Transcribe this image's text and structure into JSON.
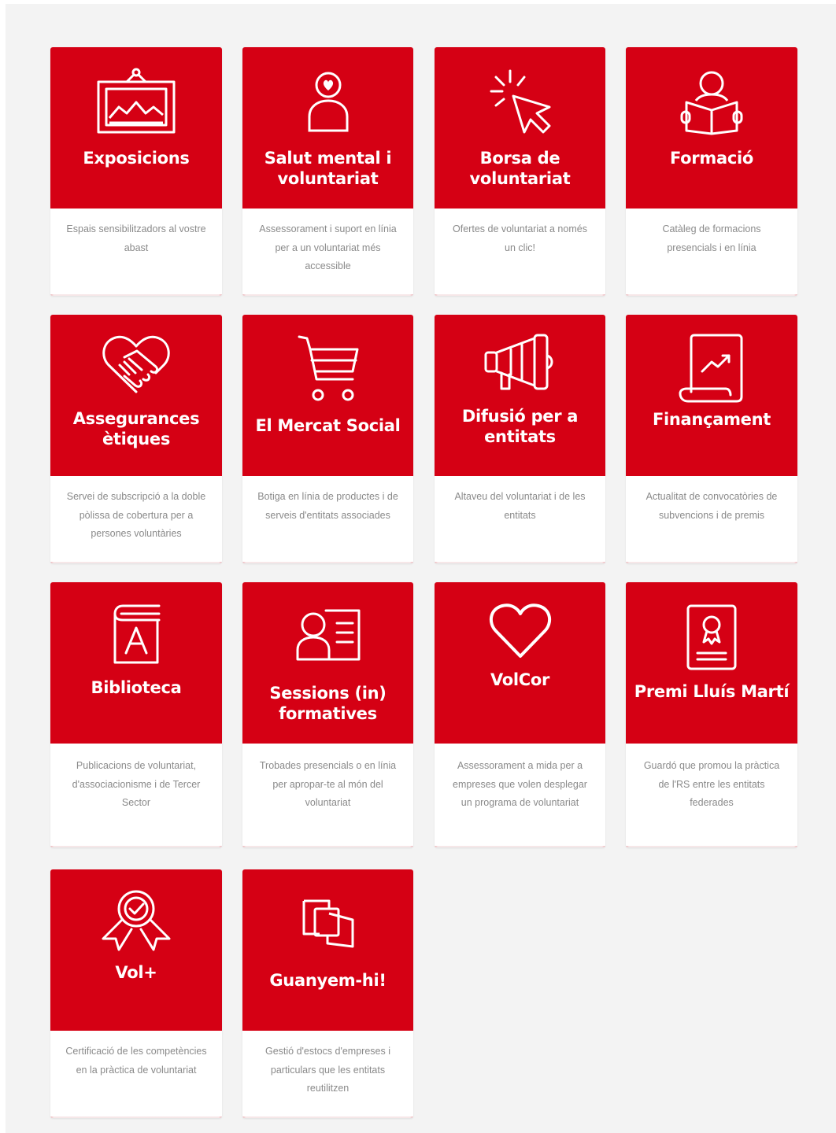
{
  "colors": {
    "accent_red": "#d50014",
    "page_bg": "#f3f3f3",
    "card_bg": "#ffffff",
    "description_text": "#8a8a8a"
  },
  "cards": [
    {
      "title": "Exposicions",
      "icon": "framed-picture-icon",
      "description": "Espais sensibilitzadors al vostre abast"
    },
    {
      "title": "Salut mental i voluntariat",
      "icon": "person-heart-icon",
      "description": "Assessorament i suport en línia per a un voluntariat més accessible"
    },
    {
      "title": "Borsa de voluntariat",
      "icon": "cursor-click-icon",
      "description": "Ofertes de voluntariat a només un clic!"
    },
    {
      "title": "Formació",
      "icon": "person-reading-icon",
      "description": "Catàleg de formacions presencials i en línia"
    },
    {
      "title": "Assegurances ètiques",
      "icon": "handshake-heart-icon",
      "description": "Servei de subscripció a la doble pòlissa de cobertura per a persones voluntàries"
    },
    {
      "title": "El Mercat Social",
      "icon": "shopping-cart-icon",
      "description": "Botiga en línia de productes i de serveis d'entitats associades"
    },
    {
      "title": "Difusió per a entitats",
      "icon": "megaphone-icon",
      "description": "Altaveu del voluntariat i de les entitats"
    },
    {
      "title": "Finançament",
      "icon": "document-chart-icon",
      "description": "Actualitat de convocatòries de subvencions i de premis"
    },
    {
      "title": "Biblioteca",
      "icon": "book-icon",
      "description": "Publicacions de voluntariat, d'associacionisme i de Tercer Sector"
    },
    {
      "title": "Sessions (in) formatives",
      "icon": "id-card-icon",
      "description": "Trobades presencials o en línia per apropar-te al món del voluntariat"
    },
    {
      "title": "VolCor",
      "icon": "heart-icon",
      "description": "Assessorament a mida per a empreses que volen desplegar un programa de voluntariat"
    },
    {
      "title": "Premi Lluís Martí",
      "icon": "award-certificate-icon",
      "description": "Guardó que promou la pràctica de l'RS entre les entitats federades"
    },
    {
      "title": "Vol+",
      "icon": "badge-ribbon-icon",
      "description": "Certificació de les competències en la pràctica de voluntariat"
    },
    {
      "title": "Guanyem-hi!",
      "icon": "overlapping-squares-icon",
      "description": "Gestió d'estocs d'empreses i particulars que les entitats reutilitzen"
    }
  ]
}
